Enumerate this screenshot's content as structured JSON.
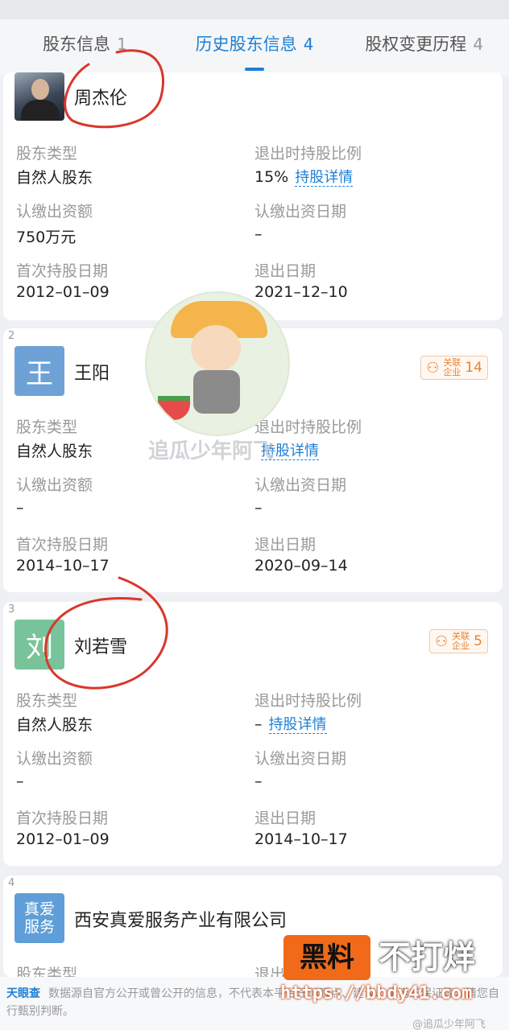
{
  "tabs": [
    {
      "label": "股东信息",
      "count": "1",
      "active": false
    },
    {
      "label": "历史股东信息",
      "count": "4",
      "active": true
    },
    {
      "label": "股权变更历程",
      "count": "4",
      "active": false
    }
  ],
  "labels": {
    "type": "股东类型",
    "exit_ratio": "退出时持股比例",
    "subscribed_amount": "认缴出资额",
    "subscribed_date": "认缴出资日期",
    "first_hold_date": "首次持股日期",
    "exit_date": "退出日期",
    "detail_link": "持股详情",
    "badge_label": "关联企业"
  },
  "shareholders": [
    {
      "name": "周杰伦",
      "avatar_text": "",
      "type": "自然人股东",
      "exit_ratio": "15%",
      "subscribed_amount": "750万元",
      "subscribed_date": "–",
      "first_hold_date": "2012–01–09",
      "exit_date": "2021–12–10"
    },
    {
      "index": "2",
      "name": "王阳",
      "avatar_text": "王",
      "badge_count": "14",
      "type": "自然人股东",
      "exit_ratio": "",
      "subscribed_amount": "–",
      "subscribed_date": "–",
      "first_hold_date": "2014–10–17",
      "exit_date": "2020–09–14"
    },
    {
      "index": "3",
      "name": "刘若雪",
      "avatar_text": "刘",
      "badge_count": "5",
      "type": "自然人股东",
      "exit_ratio": "–",
      "subscribed_amount": "–",
      "subscribed_date": "–",
      "first_hold_date": "2012–01–09",
      "exit_date": "2014–10–17"
    },
    {
      "index": "4",
      "name": "西安真爱服务产业有限公司",
      "avatar_text": "真爱服务",
      "type": "股东类型",
      "exit_ratio": "退出"
    }
  ],
  "footer": {
    "brand": "天眼查",
    "text": "数据源自官方公开或曾公开的信息，不代表本平台任何观点、建议、承诺或保证等，请您自行甄别判断。"
  },
  "watermark": "追瓜少年阿飞",
  "promo": {
    "box": "黑料",
    "right": "不打烊",
    "url": "https://bbdy41.com"
  },
  "weibo": "@追瓜少年阿飞",
  "colors": {
    "accent": "#1d7fd6",
    "badge": "#e68436",
    "annotation": "#d9362b"
  }
}
